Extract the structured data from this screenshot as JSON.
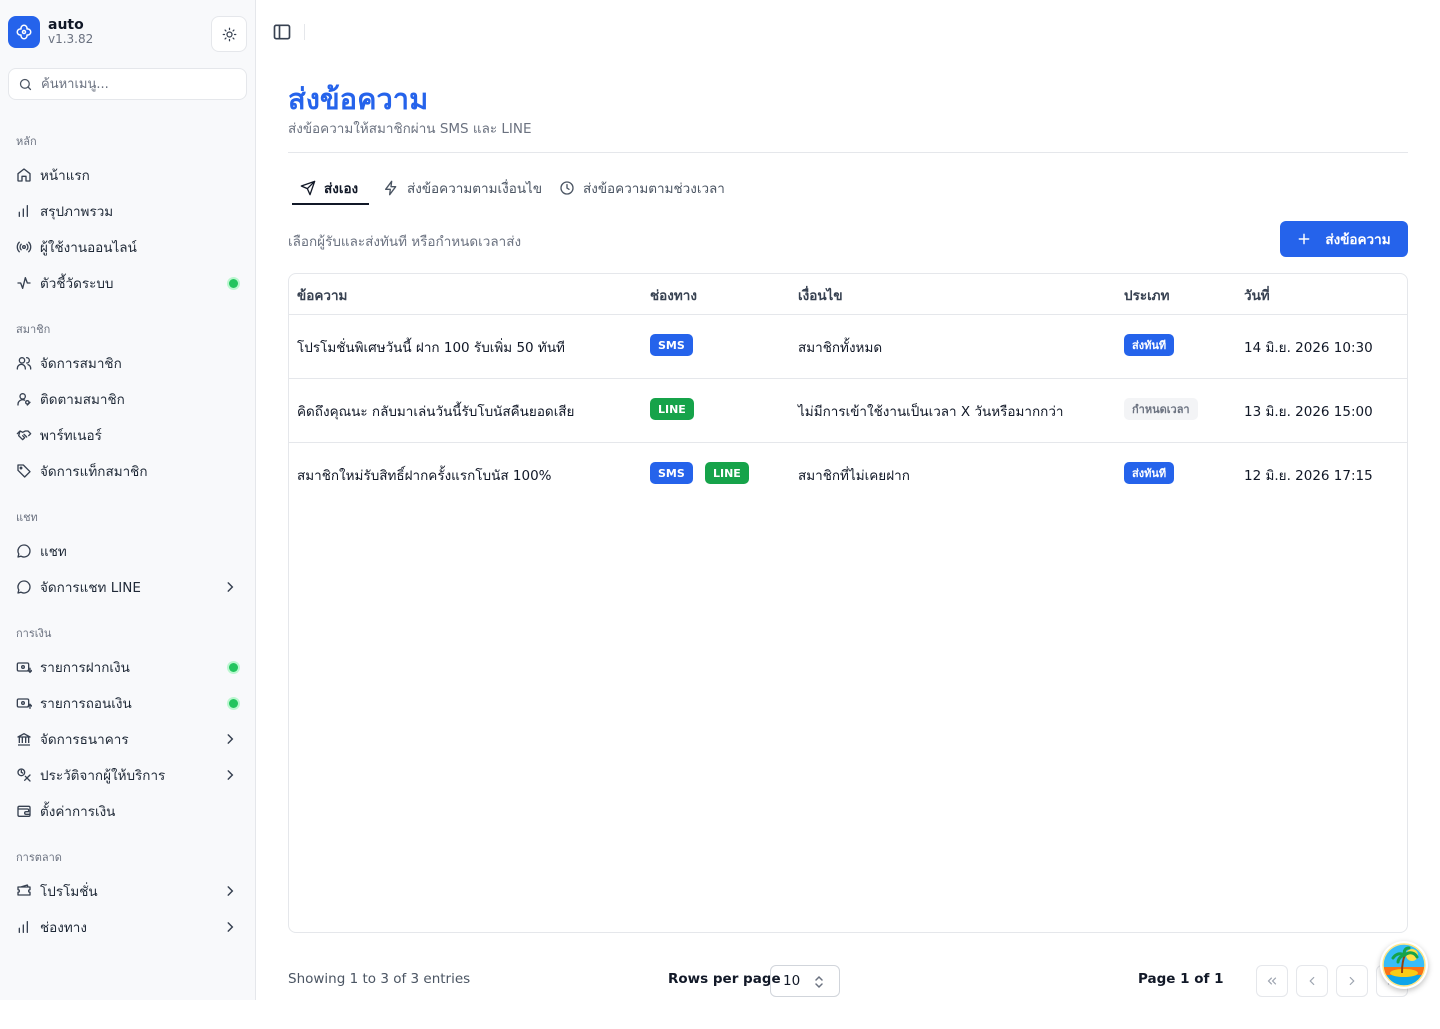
{
  "app": {
    "name": "auto",
    "version": "v1.3.82",
    "accent": "#2563eb",
    "status_green": "#22c55e"
  },
  "search": {
    "placeholder": "ค้นหาเมนู..."
  },
  "sidebar": {
    "sections": [
      {
        "title": "หลัก",
        "items": [
          {
            "label": "หน้าแรก",
            "icon": "home-icon"
          },
          {
            "label": "สรุปภาพรวม",
            "icon": "bar-chart-icon"
          },
          {
            "label": "ผู้ใช้งานออนไลน์",
            "icon": "radio-icon"
          },
          {
            "label": "ตัวชี้วัดระบบ",
            "icon": "activity-icon",
            "status_dot": true
          }
        ]
      },
      {
        "title": "สมาชิก",
        "items": [
          {
            "label": "จัดการสมาชิก",
            "icon": "users-icon"
          },
          {
            "label": "ติดตามสมาชิก",
            "icon": "user-search-icon"
          },
          {
            "label": "พาร์ทเนอร์",
            "icon": "handshake-icon"
          },
          {
            "label": "จัดการแท็กสมาชิก",
            "icon": "tag-icon"
          }
        ]
      },
      {
        "title": "แชท",
        "items": [
          {
            "label": "แชท",
            "icon": "chat-icon"
          },
          {
            "label": "จัดการแชท LINE",
            "icon": "chat-icon",
            "expandable": true
          }
        ]
      },
      {
        "title": "การเงิน",
        "items": [
          {
            "label": "รายการฝากเงิน",
            "icon": "money-in-icon",
            "status_dot": true
          },
          {
            "label": "รายการถอนเงิน",
            "icon": "money-out-icon",
            "status_dot": true
          },
          {
            "label": "จัดการธนาคาร",
            "icon": "bank-icon",
            "expandable": true
          },
          {
            "label": "ประวัติจากผู้ให้บริการ",
            "icon": "provider-history-icon",
            "expandable": true
          },
          {
            "label": "ตั้งค่าการเงิน",
            "icon": "wallet-icon"
          }
        ]
      },
      {
        "title": "การตลาด",
        "items": [
          {
            "label": "โปรโมชั่น",
            "icon": "ticket-icon",
            "expandable": true
          },
          {
            "label": "ช่องทาง",
            "icon": "bar-chart-icon",
            "expandable": true
          }
        ]
      }
    ]
  },
  "page": {
    "title": "ส่งข้อความ",
    "subtitle": "ส่งข้อความให้สมาชิกผ่าน SMS และ LINE",
    "hint": "เลือกผู้รับและส่งทันที หรือกำหนดเวลาส่ง",
    "send_button": "ส่งข้อความ"
  },
  "tabs": [
    {
      "label": "ส่งเอง",
      "icon": "send-icon",
      "active": true
    },
    {
      "label": "ส่งข้อความตามเงื่อนไข",
      "icon": "zap-icon",
      "active": false
    },
    {
      "label": "ส่งข้อความตามช่วงเวลา",
      "icon": "clock-icon",
      "active": false
    }
  ],
  "table": {
    "columns": [
      "ข้อความ",
      "ช่องทาง",
      "เงื่อนไข",
      "ประเภท",
      "วันที่"
    ],
    "rows": [
      {
        "message": "โปรโมชั่นพิเศษวันนี้ ฝาก 100 รับเพิ่ม 50 ทันที",
        "channels": [
          "SMS"
        ],
        "condition": "สมาชิกทั้งหมด",
        "type": "ส่งทันที",
        "date": "14 มิ.ย. 2026 10:30"
      },
      {
        "message": "คิดถึงคุณนะ กลับมาเล่นวันนี้รับโบนัสคืนยอดเสีย",
        "channels": [
          "LINE"
        ],
        "condition": "ไม่มีการเข้าใช้งานเป็นเวลา X วันหรือมากกว่า",
        "type": "กำหนดเวลา",
        "date": "13 มิ.ย. 2026 15:00"
      },
      {
        "message": "สมาชิกใหม่รับสิทธิ์ฝากครั้งแรกโบนัส 100%",
        "channels": [
          "SMS",
          "LINE"
        ],
        "condition": "สมาชิกที่ไม่เคยฝาก",
        "type": "ส่งทันที",
        "date": "12 มิ.ย. 2026 17:15"
      }
    ]
  },
  "pagination": {
    "showing": "Showing 1 to 3 of 3 entries",
    "rows_per_page_label": "Rows per page",
    "rows_per_page_value": "10",
    "page_info": "Page 1 of 1"
  }
}
